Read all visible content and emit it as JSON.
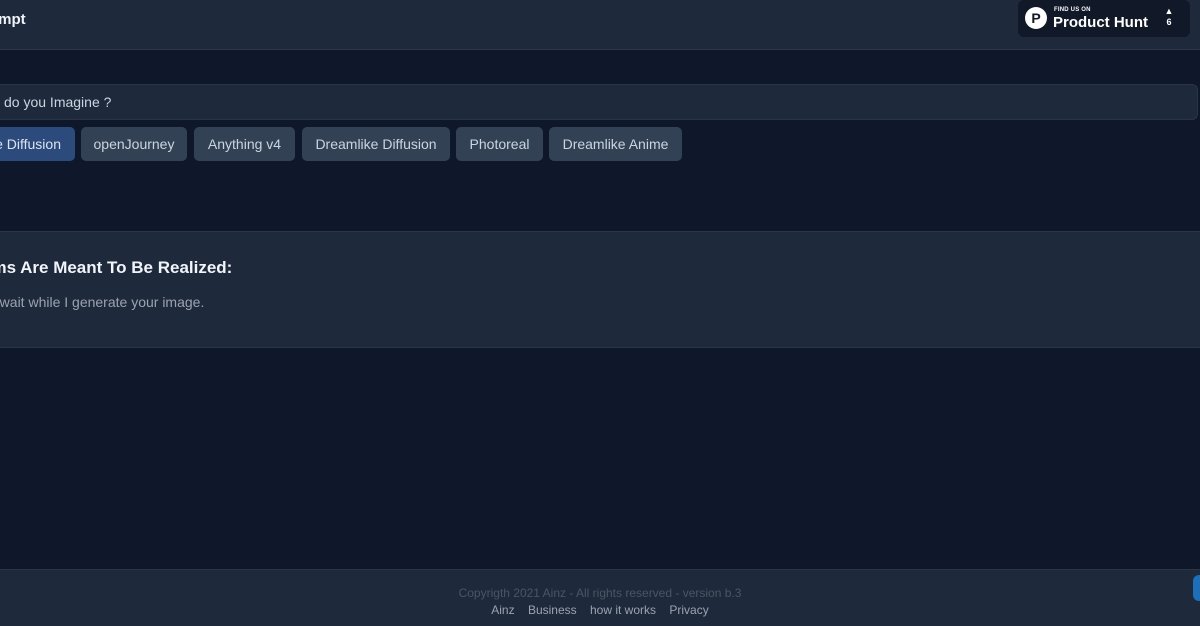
{
  "header": {
    "brand": "ompt",
    "product_hunt": {
      "small_label": "FIND US ON",
      "big_label": "Product Hunt",
      "logo_letter": "P",
      "upvote_arrow": "▲",
      "upvote_count": "6"
    }
  },
  "prompt": {
    "placeholder": "do you Imagine ?"
  },
  "models": [
    {
      "label": "e Diffusion",
      "active": true
    },
    {
      "label": "openJourney",
      "active": false
    },
    {
      "label": "Anything v4",
      "active": false
    },
    {
      "label": "Dreamlike Diffusion",
      "active": false
    },
    {
      "label": "Photoreal",
      "active": false
    },
    {
      "label": "Dreamlike Anime",
      "active": false
    }
  ],
  "status": {
    "title": "ams Are Meant To Be Realized:",
    "message": "se wait while I generate your image."
  },
  "footer": {
    "copyright": "Copyrigth 2021 Ainz - All rights reserved - version b.3",
    "links": [
      "Ainz",
      "Business",
      "how it works",
      "Privacy"
    ]
  },
  "colors": {
    "background": "#0f172a",
    "panel": "#1e293b",
    "button": "#334155",
    "button_active": "#2c4a7c"
  }
}
